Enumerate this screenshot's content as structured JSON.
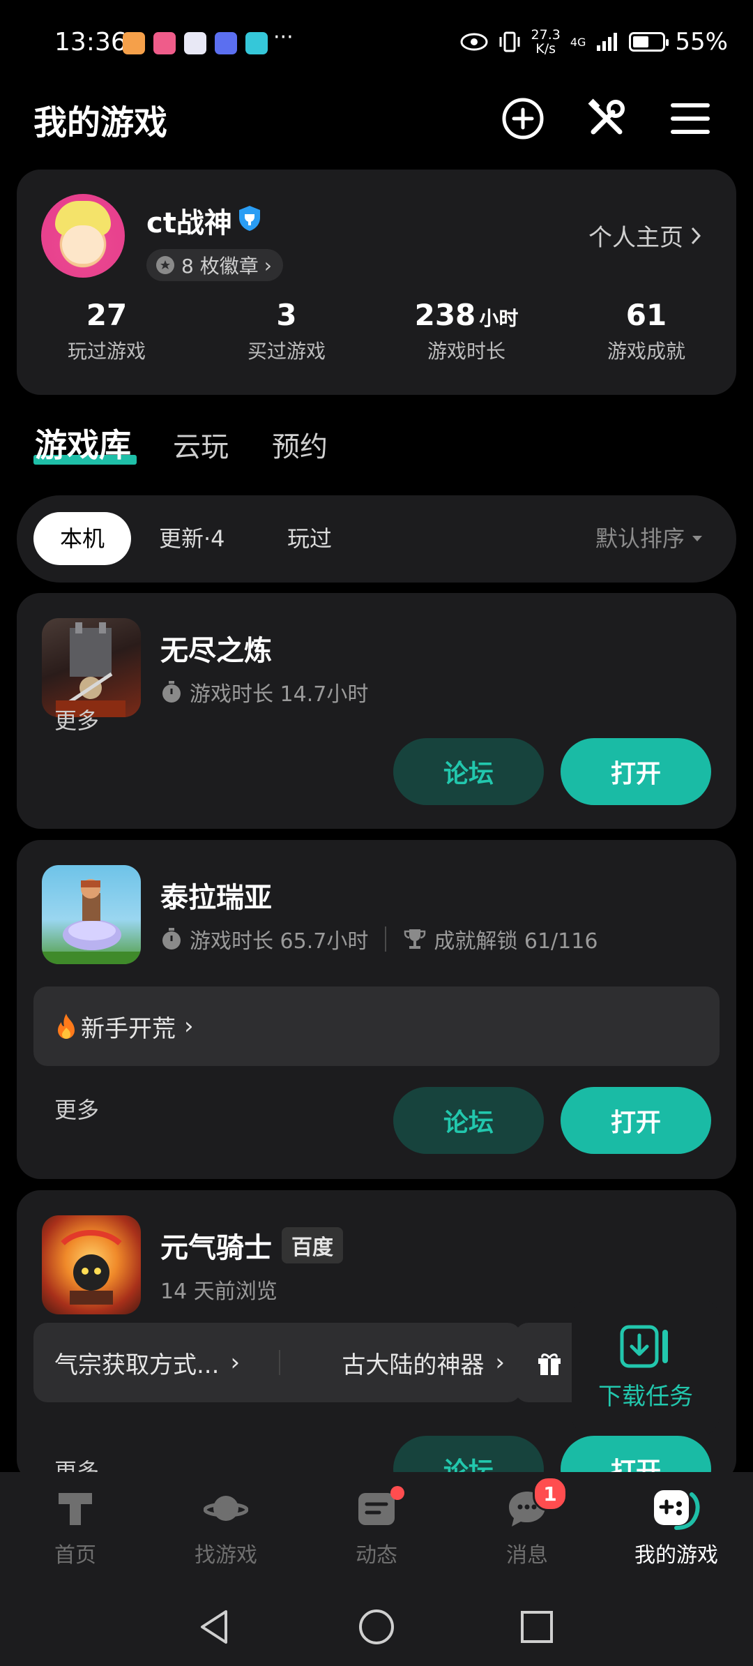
{
  "status": {
    "time": "13:36",
    "net_speed_value": "27.3",
    "net_speed_unit": "K/s",
    "signal_tag": "4G",
    "battery": "55%",
    "battery_level": 0.55
  },
  "header": {
    "title": "我的游戏",
    "icons": [
      "add-circle-icon",
      "tools-icon",
      "menu-icon"
    ]
  },
  "profile": {
    "username": "ct战神",
    "badges": "8 枚徽章",
    "homepage": "个人主页",
    "stats": [
      {
        "value": "27",
        "unit": "",
        "label": "玩过游戏"
      },
      {
        "value": "3",
        "unit": "",
        "label": "买过游戏"
      },
      {
        "value": "238",
        "unit": "小时",
        "label": "游戏时长"
      },
      {
        "value": "61",
        "unit": "",
        "label": "游戏成就"
      }
    ]
  },
  "tabs": [
    "游戏库",
    "云玩",
    "预约"
  ],
  "filters": {
    "chips": [
      "本机",
      "更新·4",
      "玩过"
    ],
    "sort": "默认排序"
  },
  "games": [
    {
      "name": "无尽之炼",
      "playtime": "游戏时长 14.7小时",
      "more": "更多",
      "forum": "论坛",
      "open": "打开"
    },
    {
      "name": "泰拉瑞亚",
      "playtime": "游戏时长 65.7小时",
      "achievement": "成就解锁 61/116",
      "topic": "新手开荒",
      "more": "更多",
      "forum": "论坛",
      "open": "打开"
    },
    {
      "name": "元气骑士",
      "tag": "百度",
      "recent": "14 天前浏览",
      "tips": [
        "气宗获取方式...",
        "古大陆的神器"
      ],
      "more": "更多",
      "forum": "论坛",
      "open": "打开"
    }
  ],
  "download": {
    "label": "下载任务"
  },
  "nav": {
    "items": [
      "首页",
      "找游戏",
      "动态",
      "消息",
      "我的游戏"
    ],
    "message_badge": "1"
  }
}
